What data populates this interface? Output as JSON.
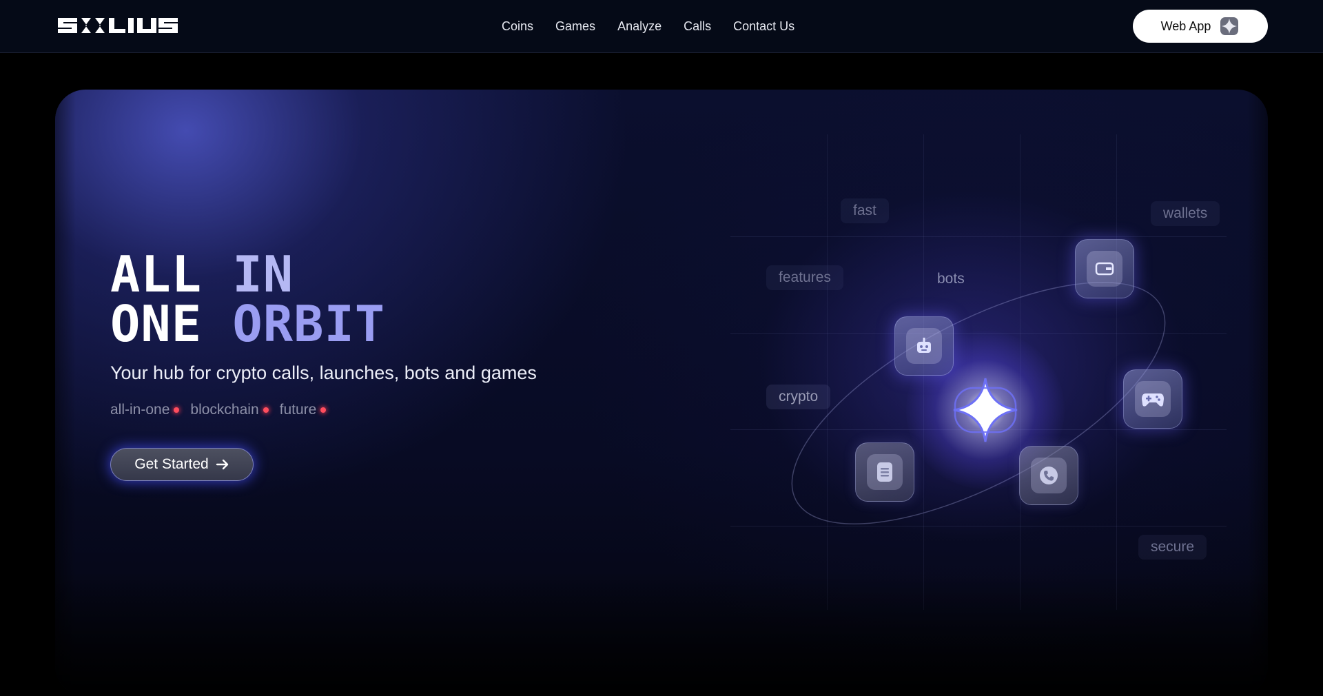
{
  "header": {
    "logo_text": "SOLIUS",
    "nav": [
      {
        "label": "Coins"
      },
      {
        "label": "Games"
      },
      {
        "label": "Analyze"
      },
      {
        "label": "Calls"
      },
      {
        "label": "Contact Us"
      }
    ],
    "web_app_label": "Web App"
  },
  "hero": {
    "headline_line1_word1": "ALL",
    "headline_line1_word2": "IN",
    "headline_line2_word1": "ONE",
    "headline_line2_word2": "ORBIT",
    "subtitle": "Your hub for crypto calls, launches, bots and games",
    "tags": [
      {
        "label": "all-in-one"
      },
      {
        "label": "blockchain"
      },
      {
        "label": "future"
      }
    ],
    "cta_label": "Get Started"
  },
  "orbit": {
    "words": {
      "fast": "fast",
      "wallets": "wallets",
      "features": "features",
      "bots": "bots",
      "crypto": "crypto",
      "secure": "secure"
    },
    "tiles": [
      "wallet-icon",
      "bot-icon",
      "gamepad-icon",
      "document-icon",
      "phone-icon"
    ],
    "center_icon": "sparkle-star-icon"
  },
  "colors": {
    "accent": "#9a9df2",
    "header_bg": "#050a17",
    "tag_dot": "#ff4d5e"
  }
}
